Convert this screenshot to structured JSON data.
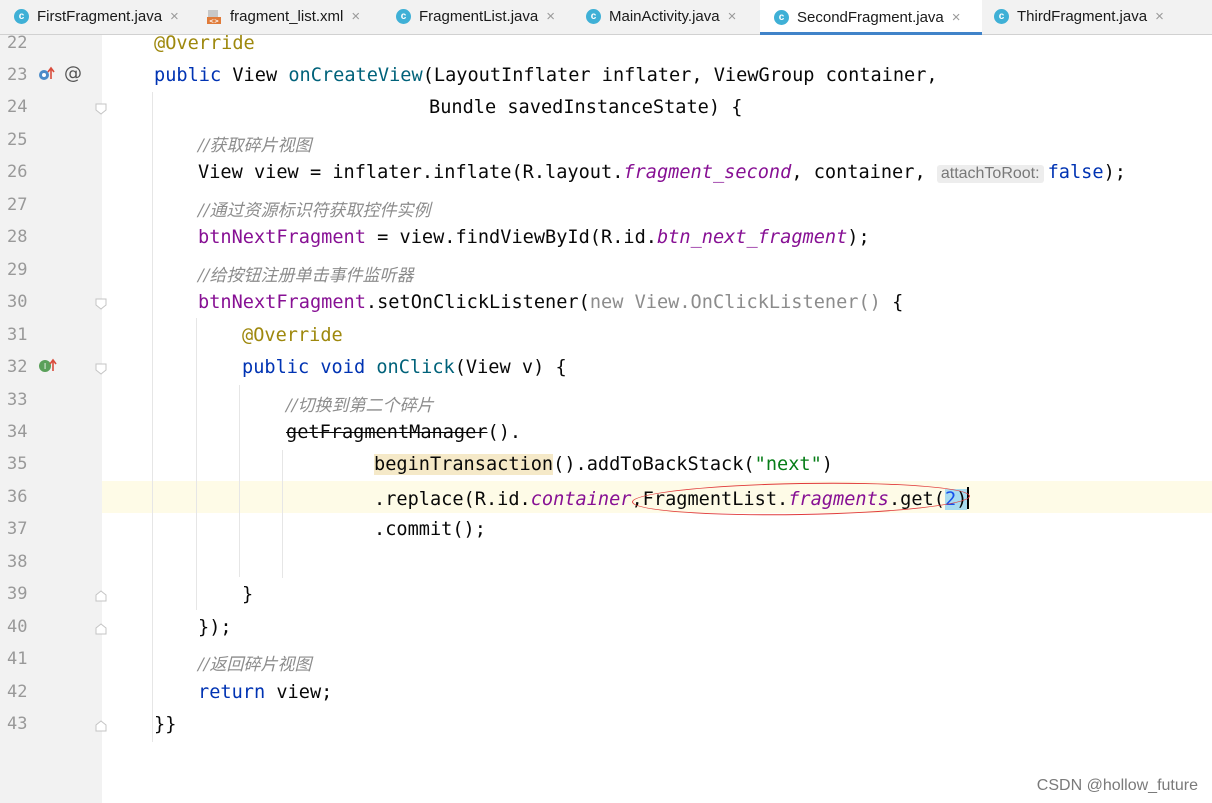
{
  "tabs": [
    {
      "label": "FirstFragment.java",
      "icon": "class-icon",
      "active": false
    },
    {
      "label": "fragment_list.xml",
      "icon": "xml-file-icon",
      "active": false
    },
    {
      "label": "FragmentList.java",
      "icon": "class-icon",
      "active": false
    },
    {
      "label": "MainActivity.java",
      "icon": "class-icon",
      "active": false
    },
    {
      "label": "SecondFragment.java",
      "icon": "class-icon",
      "active": true
    },
    {
      "label": "ThirdFragment.java",
      "icon": "class-icon",
      "active": false
    }
  ],
  "tab_close": "×",
  "class_icon_letter": "c",
  "gutter": {
    "line_numbers": [
      "22",
      "23",
      "24",
      "25",
      "26",
      "27",
      "28",
      "29",
      "30",
      "31",
      "32",
      "33",
      "34",
      "35",
      "36",
      "37",
      "38",
      "39",
      "40",
      "41",
      "42",
      "43"
    ],
    "override_marker_at": "@",
    "implements_marker": "I"
  },
  "code": {
    "l22": "@Override",
    "l23_public": "public",
    "l23_view": " View ",
    "l23_method": "onCreateView",
    "l23_rest": "(LayoutInflater inflater, ViewGroup container,",
    "l24": "Bundle savedInstanceState) {",
    "l25": "//获取碎片视图",
    "l26_a": "View view = inflater.inflate(R.layout.",
    "l26_field": "fragment_second",
    "l26_b": ", container, ",
    "l26_hint": "attachToRoot:",
    "l26_false": "false",
    "l26_c": ");",
    "l27": "//通过资源标识符获取控件实例",
    "l28_field": "btnNextFragment",
    "l28_a": " = view.findViewById(R.id.",
    "l28_id": "btn_next_fragment",
    "l28_b": ");",
    "l29": "//给按钮注册单击事件监听器",
    "l30_field": "btnNextFragment",
    "l30_a": ".setOnClickListener(",
    "l30_new": "new View.OnClickListener()",
    "l30_b": " {",
    "l31": "@Override",
    "l32_kw": "public void ",
    "l32_method": "onClick",
    "l32_rest": "(View v) {",
    "l33": "//切换到第二个碎片",
    "l34_a": "getFragmentManager",
    "l34_b": "().",
    "l35_a": "beginTransaction",
    "l35_b": "().addToBackStack(",
    "l35_str": "\"next\"",
    "l35_c": ")",
    "l36_a": ".replace(R.id.",
    "l36_field": "container",
    "l36_b": ",FragmentList.",
    "l36_list": "fragments",
    "l36_c": ".get(",
    "l36_num": "2",
    "l36_d": ")",
    "l37": ".commit();",
    "l39": "}",
    "l40": "});",
    "l41": "//返回碎片视图",
    "l42_kw": "return",
    "l42_rest": " view;",
    "l43": "}}"
  },
  "watermark": "CSDN @hollow_future",
  "colors": {
    "keyword": "#0033b3",
    "annotation": "#9e880d",
    "comment": "#8c8c8c",
    "field": "#871094",
    "method": "#00627a",
    "string": "#067d17",
    "number": "#1750eb",
    "active_tab_underline": "#4083c9",
    "annotation_ellipse": "#e03b3b"
  }
}
